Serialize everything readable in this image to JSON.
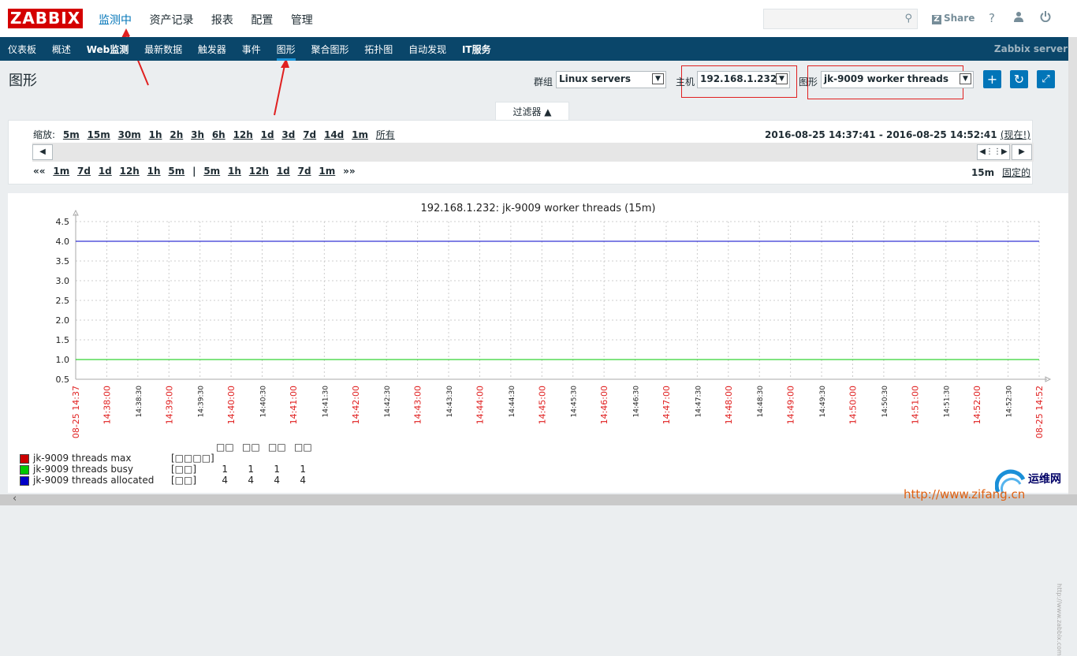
{
  "header": {
    "logo": "ZABBIX",
    "nav": [
      "监测中",
      "资产记录",
      "报表",
      "配置",
      "管理"
    ],
    "share_label": "Share",
    "help_icon": "?",
    "user_icon": "user-icon",
    "power_icon": "power-icon"
  },
  "subnav": {
    "items": [
      "仪表板",
      "概述",
      "Web监测",
      "最新数据",
      "触发器",
      "事件",
      "图形",
      "聚合图形",
      "拓扑图",
      "自动发现",
      "IT服务"
    ],
    "active": "图形",
    "server_name": "Zabbix server"
  },
  "page": {
    "title": "图形",
    "group_label": "群组",
    "group_value": "Linux servers",
    "host_label": "主机",
    "host_value": "192.168.1.232",
    "graph_label": "图形",
    "graph_value": "jk-9009 worker threads"
  },
  "filter": {
    "tab_label": "过滤器 ▲",
    "zoom_label": "缩放:",
    "zoom_options": [
      "5m",
      "15m",
      "30m",
      "1h",
      "2h",
      "3h",
      "6h",
      "12h",
      "1d",
      "3d",
      "7d",
      "14d",
      "1m",
      "所有"
    ],
    "period_text": "2016-08-25 14:37:41 - 2016-08-25 14:52:41",
    "now_text": "(现在!)",
    "shift_back": [
      "««",
      "1m",
      "7d",
      "1d",
      "12h",
      "1h",
      "5m"
    ],
    "shift_sep": "|",
    "shift_fwd": [
      "5m",
      "1h",
      "12h",
      "1d",
      "7d",
      "1m",
      "»»"
    ],
    "period_length": "15m",
    "fixed_label": "固定的"
  },
  "chart_data": {
    "type": "line",
    "title": "192.168.1.232: jk-9009 worker threads (15m)",
    "ylim": [
      0.5,
      4.5
    ],
    "y_ticks": [
      "0.5",
      "1.0",
      "1.5",
      "2.0",
      "2.5",
      "3.0",
      "3.5",
      "4.0",
      "4.5"
    ],
    "x_ticks": [
      {
        "label": "08-25 14:37",
        "major": true
      },
      {
        "label": "14:38:00",
        "major": true
      },
      {
        "label": "14:38:30",
        "major": false
      },
      {
        "label": "14:39:00",
        "major": true
      },
      {
        "label": "14:39:30",
        "major": false
      },
      {
        "label": "14:40:00",
        "major": true
      },
      {
        "label": "14:40:30",
        "major": false
      },
      {
        "label": "14:41:00",
        "major": true
      },
      {
        "label": "14:41:30",
        "major": false
      },
      {
        "label": "14:42:00",
        "major": true
      },
      {
        "label": "14:42:30",
        "major": false
      },
      {
        "label": "14:43:00",
        "major": true
      },
      {
        "label": "14:43:30",
        "major": false
      },
      {
        "label": "14:44:00",
        "major": true
      },
      {
        "label": "14:44:30",
        "major": false
      },
      {
        "label": "14:45:00",
        "major": true
      },
      {
        "label": "14:45:30",
        "major": false
      },
      {
        "label": "14:46:00",
        "major": true
      },
      {
        "label": "14:46:30",
        "major": false
      },
      {
        "label": "14:47:00",
        "major": true
      },
      {
        "label": "14:47:30",
        "major": false
      },
      {
        "label": "14:48:00",
        "major": true
      },
      {
        "label": "14:48:30",
        "major": false
      },
      {
        "label": "14:49:00",
        "major": true
      },
      {
        "label": "14:49:30",
        "major": false
      },
      {
        "label": "14:50:00",
        "major": true
      },
      {
        "label": "14:50:30",
        "major": false
      },
      {
        "label": "14:51:00",
        "major": true
      },
      {
        "label": "14:51:30",
        "major": false
      },
      {
        "label": "14:52:00",
        "major": true
      },
      {
        "label": "14:52:30",
        "major": false
      },
      {
        "label": "08-25 14:52",
        "major": true
      }
    ],
    "series": [
      {
        "name": "jk-9009 threads max",
        "color": "#cc0000",
        "values": [],
        "unit_box": "[□□□□]",
        "stats": [
          "",
          "",
          "",
          ""
        ]
      },
      {
        "name": "jk-9009 threads busy",
        "color": "#00c800",
        "values": [
          1,
          1
        ],
        "unit_box": "[□□]",
        "stats": [
          "1",
          "1",
          "1",
          "1"
        ]
      },
      {
        "name": "jk-9009 threads allocated",
        "color": "#0000c8",
        "values": [
          4,
          4
        ],
        "unit_box": "[□□]",
        "stats": [
          "4",
          "4",
          "4",
          "4"
        ]
      }
    ],
    "legend_headers": [
      "□□",
      "□□",
      "□□",
      "□□"
    ]
  },
  "watermark": {
    "site_name": "运维网",
    "url": "http://www.zifang.cn"
  }
}
